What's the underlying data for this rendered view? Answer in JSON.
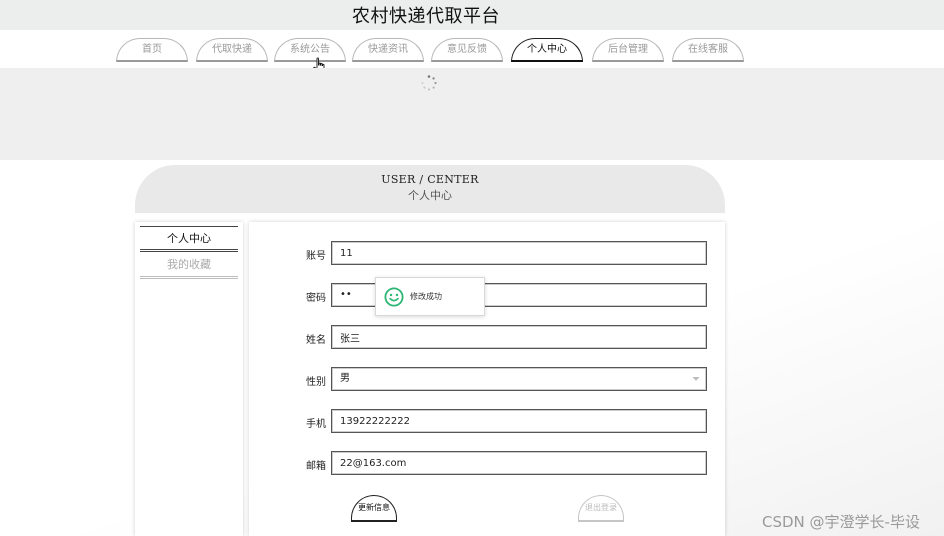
{
  "site": {
    "title": "农村快递代取平台"
  },
  "nav": {
    "tabs": [
      {
        "label": "首页"
      },
      {
        "label": "代取快递"
      },
      {
        "label": "系统公告"
      },
      {
        "label": "快递资讯"
      },
      {
        "label": "意见反馈"
      },
      {
        "label": "个人中心",
        "active": true
      },
      {
        "label": "后台管理"
      },
      {
        "label": "在线客服"
      }
    ]
  },
  "user_center": {
    "title_en": "USER / CENTER",
    "title_cn": "个人中心"
  },
  "sidebar": {
    "items": [
      {
        "label": "个人中心",
        "active": true
      },
      {
        "label": "我的收藏"
      }
    ]
  },
  "form": {
    "account": {
      "label": "账号",
      "value": "11"
    },
    "password": {
      "label": "密码",
      "value": "••"
    },
    "name": {
      "label": "姓名",
      "value": "张三"
    },
    "gender": {
      "label": "性别",
      "value": "男"
    },
    "phone": {
      "label": "手机",
      "value": "13922222222"
    },
    "email": {
      "label": "邮箱",
      "value": "22@163.com"
    }
  },
  "toast": {
    "message": "修改成功",
    "icon": "smile-icon",
    "color": "#2bb673"
  },
  "actions": {
    "update_label": "更新信息",
    "logout_label": "退出登录"
  },
  "watermark": "CSDN @宇澄学长-毕设"
}
